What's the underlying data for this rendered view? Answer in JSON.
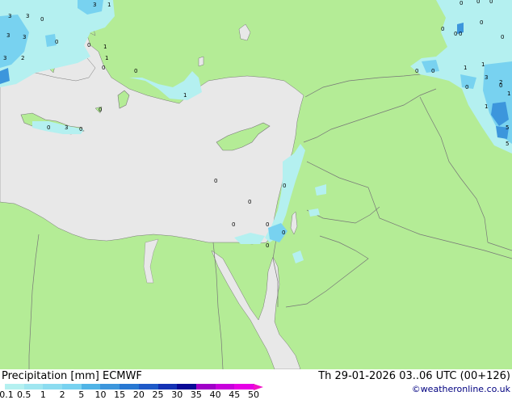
{
  "footer": {
    "left_title": "Precipitation [mm]  ECMWF",
    "datetime": "Th 29-01-2026 03..06 UTC (00+126)",
    "credit": "©weatheronline.co.uk"
  },
  "colorbar": {
    "tick_labels": [
      "0.1",
      "0.5",
      "1",
      "2",
      "5",
      "10",
      "15",
      "20",
      "25",
      "30",
      "35",
      "40",
      "45",
      "50"
    ],
    "colors": [
      "#b4f0f0",
      "#a0e6f0",
      "#8cdcf0",
      "#78d2f0",
      "#50b4e6",
      "#3c96dc",
      "#2878d2",
      "#1e5ac8",
      "#1432b4",
      "#0a0a96",
      "#a000c8",
      "#c800dc",
      "#e600e6",
      "#f014c8"
    ]
  },
  "map": {
    "land_color": "#b4ec96",
    "sea_color": "#e8e8e8",
    "precip_light_color": "#b4f0f0",
    "precip_mid_color": "#78d2f0",
    "precip_heavy_color": "#3c96dc",
    "values": [
      {
        "t": "3"
      },
      {
        "t": "1"
      },
      {
        "t": "3"
      },
      {
        "t": "3"
      },
      {
        "t": "0"
      },
      {
        "t": "3"
      },
      {
        "t": "3"
      },
      {
        "t": "0"
      },
      {
        "t": "3"
      },
      {
        "t": "2"
      },
      {
        "t": "0"
      },
      {
        "t": "1"
      },
      {
        "t": "1"
      },
      {
        "t": "0"
      },
      {
        "t": "0"
      },
      {
        "t": "1"
      },
      {
        "t": "0"
      },
      {
        "t": "0"
      },
      {
        "t": "3"
      },
      {
        "t": "0"
      },
      {
        "t": "0"
      },
      {
        "t": "0"
      },
      {
        "t": "0"
      },
      {
        "t": "0"
      },
      {
        "t": "0"
      },
      {
        "t": "0"
      },
      {
        "t": "0"
      },
      {
        "t": "0"
      },
      {
        "t": "0"
      },
      {
        "t": "0"
      },
      {
        "t": "0"
      },
      {
        "t": "0"
      },
      {
        "t": "0"
      },
      {
        "t": "0"
      },
      {
        "t": "0"
      },
      {
        "t": "1"
      },
      {
        "t": "1"
      },
      {
        "t": "0"
      },
      {
        "t": "3"
      },
      {
        "t": "0"
      },
      {
        "t": "1"
      },
      {
        "t": "2"
      },
      {
        "t": "1"
      },
      {
        "t": "5"
      },
      {
        "t": "5"
      },
      {
        "t": "0"
      },
      {
        "t": "0"
      }
    ]
  }
}
